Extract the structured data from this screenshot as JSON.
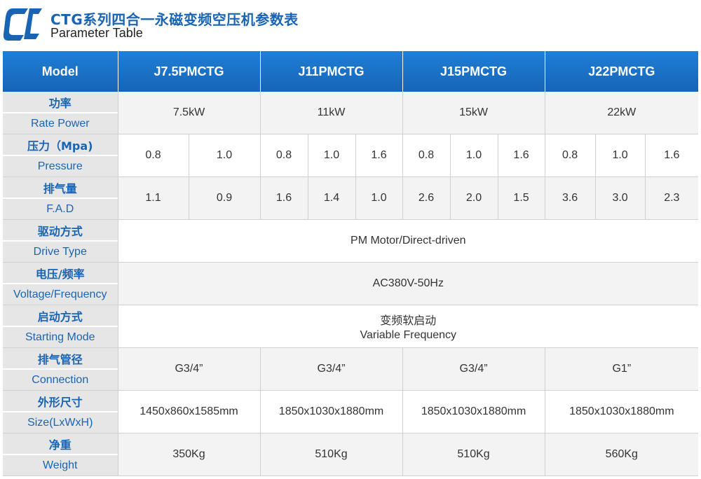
{
  "header": {
    "title_cn": "CTG系列四合一永磁变频空压机参数表",
    "title_en": "Parameter Table",
    "logo_icon": "ctg-logo-icon"
  },
  "colors": {
    "accent": "#1a64b4",
    "header_bg": "#1c74c9",
    "label_bg": "#e6e6e6",
    "row_alt": "#f3f3f3"
  },
  "table": {
    "columns": [
      "Model",
      "J7.5PMCTG",
      "J11PMCTG",
      "J15PMCTG",
      "J22PMCTG"
    ],
    "rows": {
      "power": {
        "cn": "功率",
        "en": "Rate Power",
        "values": [
          "7.5kW",
          "11kW",
          "15kW",
          "22kW"
        ]
      },
      "pressure": {
        "cn": "压力（Mpa)",
        "en": "Pressure",
        "values": [
          "0.8",
          "1.0",
          "0.8",
          "1.0",
          "1.6",
          "0.8",
          "1.0",
          "1.6",
          "0.8",
          "1.0",
          "1.6"
        ]
      },
      "fad": {
        "cn": "排气量",
        "en": "F.A.D",
        "values": [
          "1.1",
          "0.9",
          "1.6",
          "1.4",
          "1.0",
          "2.6",
          "2.0",
          "1.5",
          "3.6",
          "3.0",
          "2.3"
        ]
      },
      "drive": {
        "cn": "驱动方式",
        "en": "Drive Type",
        "value": "PM Motor/Direct-driven"
      },
      "voltage": {
        "cn": "电压/频率",
        "en": "Voltage/Frequency",
        "value": "AC380V-50Hz"
      },
      "starting": {
        "cn": "启动方式",
        "en": "Starting Mode",
        "value_cn": "变频软启动",
        "value_en": "Variable Frequency"
      },
      "connection": {
        "cn": "排气管径",
        "en": "Connection",
        "values": [
          "G3/4”",
          "G3/4”",
          "G3/4”",
          "G1”"
        ]
      },
      "size": {
        "cn": "外形尺寸",
        "en": "Size(LxWxH)",
        "values": [
          "1450x860x1585mm",
          "1850x1030x1880mm",
          "1850x1030x1880mm",
          "1850x1030x1880mm"
        ]
      },
      "weight": {
        "cn": "净重",
        "en": "Weight",
        "values": [
          "350Kg",
          "510Kg",
          "510Kg",
          "560Kg"
        ]
      }
    }
  }
}
